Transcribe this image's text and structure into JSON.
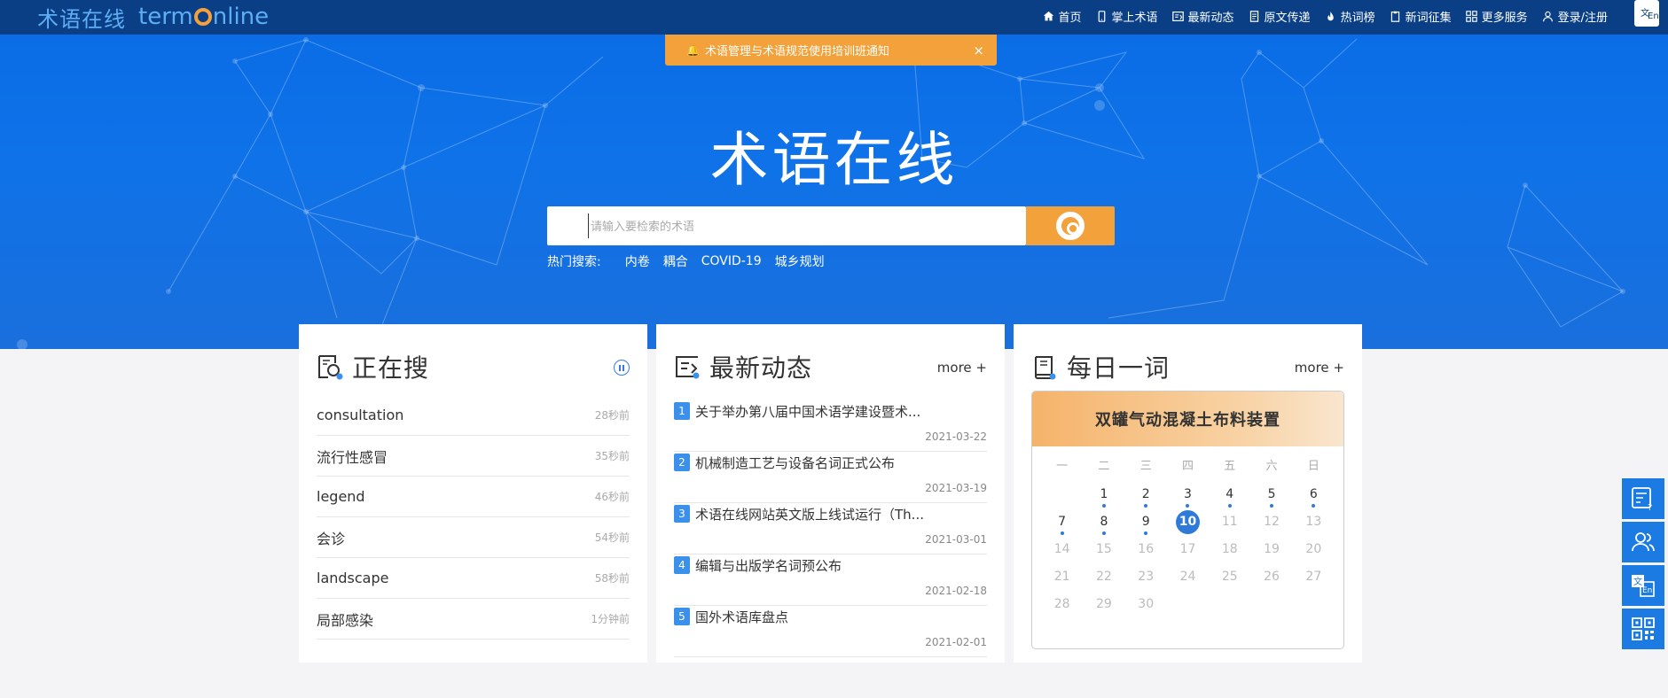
{
  "header": {
    "logo_cn": "术语在线",
    "logo_en_pre": "term",
    "logo_en_post": "nline",
    "nav": [
      {
        "label": "首页",
        "icon": "home-icon"
      },
      {
        "label": "掌上术语",
        "icon": "mobile-icon"
      },
      {
        "label": "最新动态",
        "icon": "news-icon"
      },
      {
        "label": "原文传递",
        "icon": "document-icon"
      },
      {
        "label": "热词榜",
        "icon": "flame-icon"
      },
      {
        "label": "新词征集",
        "icon": "clipboard-icon"
      },
      {
        "label": "更多服务",
        "icon": "grid-icon"
      },
      {
        "label": "登录/注册",
        "icon": "user-icon"
      }
    ],
    "lang": {
      "a": "文",
      "b": "En"
    }
  },
  "notice": {
    "text": "术语管理与术语规范使用培训班通知",
    "close": "×"
  },
  "hero": {
    "title": "术语在线"
  },
  "search": {
    "placeholder": "请输入要检索的术语"
  },
  "hot": {
    "label": "热门搜索:",
    "keywords": [
      "内卷",
      "耦合",
      "COVID-19",
      "城乡规划"
    ]
  },
  "searching": {
    "title": "正在搜",
    "items": [
      {
        "term": "consultation",
        "time": "28秒前"
      },
      {
        "term": "流行性感冒",
        "time": "35秒前"
      },
      {
        "term": "legend",
        "time": "46秒前"
      },
      {
        "term": "会诊",
        "time": "54秒前"
      },
      {
        "term": "landscape",
        "time": "58秒前"
      },
      {
        "term": "局部感染",
        "time": "1分钟前"
      }
    ]
  },
  "news": {
    "title": "最新动态",
    "more": "more +",
    "items": [
      {
        "num": "1",
        "title": "关于举办第八届中国术语学建设暨术...",
        "date": "2021-03-22"
      },
      {
        "num": "2",
        "title": "机械制造工艺与设备名词正式公布",
        "date": "2021-03-19"
      },
      {
        "num": "3",
        "title": "术语在线网站英文版上线试运行（Th...",
        "date": "2021-03-01"
      },
      {
        "num": "4",
        "title": "编辑与出版学名词预公布",
        "date": "2021-02-18"
      },
      {
        "num": "5",
        "title": "国外术语库盘点",
        "date": "2021-02-01"
      }
    ]
  },
  "daily": {
    "title": "每日一词",
    "more": "more +",
    "word": "双罐气动混凝土布料装置",
    "weekdays": [
      "一",
      "二",
      "三",
      "四",
      "五",
      "六",
      "日"
    ],
    "weeks": [
      [
        {
          "d": ""
        },
        {
          "d": "1",
          "dot": true
        },
        {
          "d": "2",
          "dot": true
        },
        {
          "d": "3",
          "dot": true
        },
        {
          "d": "4",
          "dot": true
        },
        {
          "d": "5",
          "dot": true
        },
        {
          "d": "6",
          "dot": true
        }
      ],
      [
        {
          "d": "7",
          "dot": true
        },
        {
          "d": "8",
          "dot": true
        },
        {
          "d": "9",
          "dot": true
        },
        {
          "d": "10",
          "today": true
        },
        {
          "d": "11",
          "dis": true
        },
        {
          "d": "12",
          "dis": true
        },
        {
          "d": "13",
          "dis": true
        }
      ],
      [
        {
          "d": "14",
          "dis": true
        },
        {
          "d": "15",
          "dis": true
        },
        {
          "d": "16",
          "dis": true
        },
        {
          "d": "17",
          "dis": true
        },
        {
          "d": "18",
          "dis": true
        },
        {
          "d": "19",
          "dis": true
        },
        {
          "d": "20",
          "dis": true
        }
      ],
      [
        {
          "d": "21",
          "dis": true
        },
        {
          "d": "22",
          "dis": true
        },
        {
          "d": "23",
          "dis": true
        },
        {
          "d": "24",
          "dis": true
        },
        {
          "d": "25",
          "dis": true
        },
        {
          "d": "26",
          "dis": true
        },
        {
          "d": "27",
          "dis": true
        }
      ],
      [
        {
          "d": "28",
          "dis": true
        },
        {
          "d": "29",
          "dis": true
        },
        {
          "d": "30",
          "dis": true
        },
        {
          "d": ""
        },
        {
          "d": ""
        },
        {
          "d": ""
        },
        {
          "d": ""
        }
      ]
    ]
  },
  "float": [
    {
      "icon": "feedback-icon"
    },
    {
      "icon": "users-icon"
    },
    {
      "icon": "language-icon"
    },
    {
      "icon": "qrcode-icon"
    }
  ],
  "colors": {
    "brand": "#0a3f86",
    "accent": "#f3a23b",
    "primary": "#1b7be3"
  }
}
